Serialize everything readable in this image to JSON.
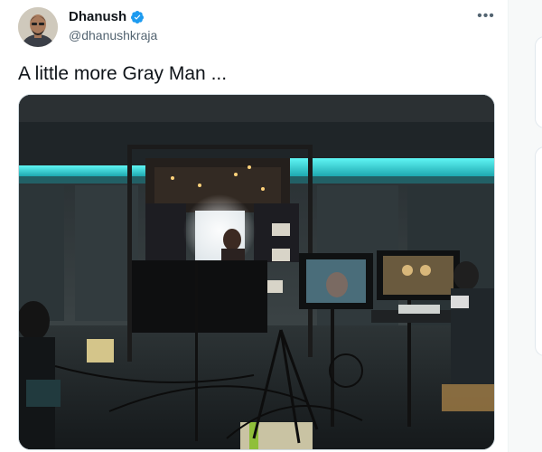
{
  "author": {
    "display_name": "Dhanush",
    "handle": "@dhanushkraja",
    "verified": true,
    "avatar_icon": "profile-photo"
  },
  "tweet": {
    "text": "A little more Gray Man ...",
    "more_icon": "more-horizontal-icon",
    "more_label": "•••"
  },
  "media": {
    "description_icon": "behind-the-scenes-photo"
  },
  "colors": {
    "text_primary": "#0f1419",
    "text_secondary": "#536471",
    "verified_blue": "#1d9bf0",
    "border": "#cfd9de"
  }
}
